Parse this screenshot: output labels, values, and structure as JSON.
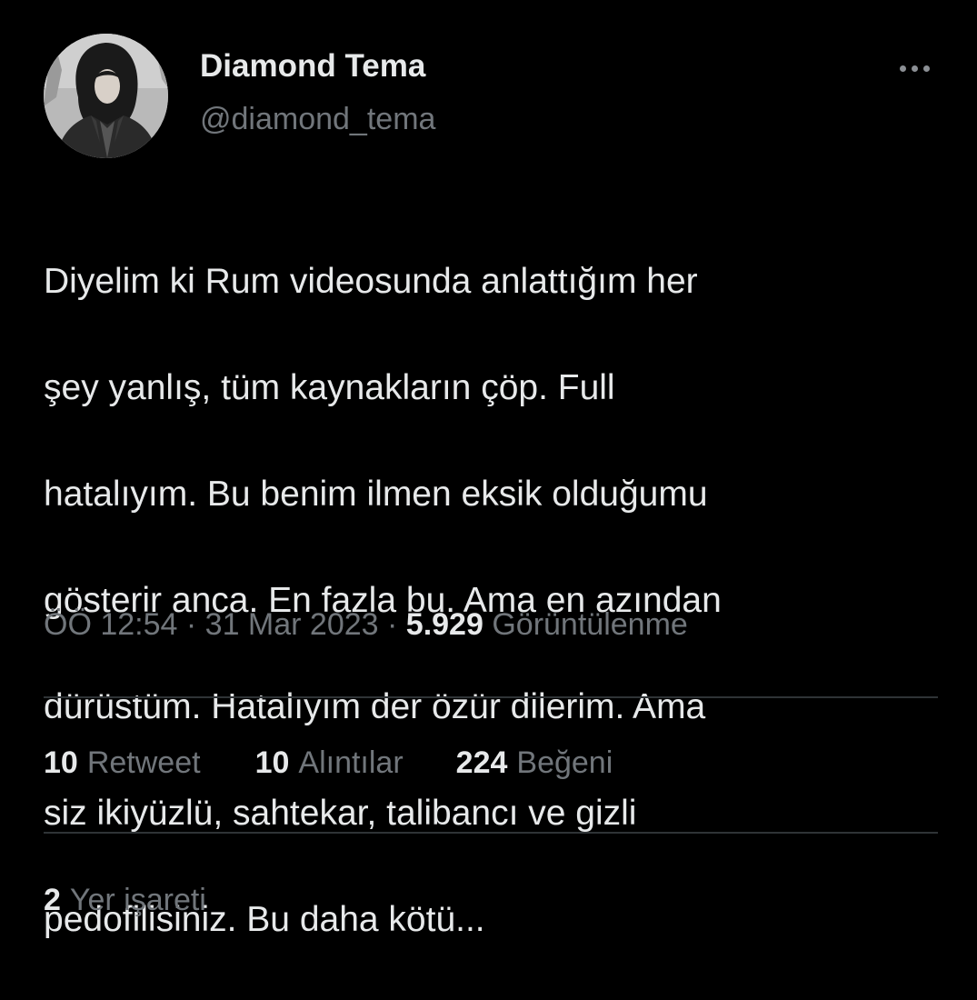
{
  "author": {
    "display_name": "Diamond Tema",
    "handle": "@diamond_tema"
  },
  "tweet": {
    "text_lines": [
      "Diyelim ki Rum videosunda anlattığım her",
      "şey yanlış, tüm kaynakların çöp. Full",
      "hatalıyım. Bu benim ilmen eksik olduğumu",
      "gösterir anca. En fazla bu. Ama en azından",
      "dürüstüm. Hatalıyım der özür dilerim. Ama",
      "siz ikiyüzlü, sahtekar, talibancı ve gizli",
      "pedofilisiniz. Bu daha kötü..."
    ],
    "time": "ÖÖ 12:54",
    "date": "31 Mar 2023",
    "separator": "·",
    "views_count": "5.929",
    "views_label": "Görüntülenme"
  },
  "stats": {
    "retweets": {
      "count": "10",
      "label": "Retweet"
    },
    "quotes": {
      "count": "10",
      "label": "Alıntılar"
    },
    "likes": {
      "count": "224",
      "label": "Beğeni"
    },
    "bookmarks": {
      "count": "2",
      "label": "Yer işareti"
    }
  },
  "icons": {
    "more": "more-horizontal-icon"
  },
  "colors": {
    "background": "#000000",
    "primary_text": "#e7e9ea",
    "secondary_text": "#71767b",
    "divider": "#2f3336"
  }
}
